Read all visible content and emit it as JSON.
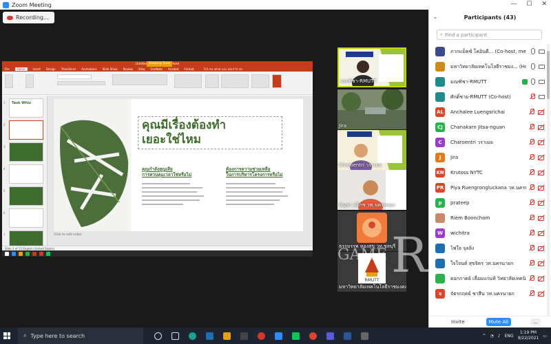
{
  "window": {
    "title": "Zoom Meeting"
  },
  "recording": {
    "label": "Recording..."
  },
  "powerpoint": {
    "window_title": "Untitled design - PowerPoint",
    "drawing_tools_tab": "Drawing Tools",
    "tabs": [
      "File",
      "Home",
      "Insert",
      "Design",
      "Transitions",
      "Animations",
      "Slide Show",
      "Review",
      "View",
      "OneNote",
      "Acrobat",
      "Format"
    ],
    "tell_me": "Tell me what you want to do",
    "slide": {
      "title_line1": "คุณมีเรื่องต้องทำ",
      "title_line2": "เยอะใช่ไหม",
      "col1_head_line1": "คุณกำลังสูญเสีย",
      "col1_head_line2": "การควบคุมเวลาใช่หรือไม่",
      "col2_head_line1": "ต้องการความช่วยเหลือ",
      "col2_head_line2": "ในการบริหารโครงการหรือไม่"
    },
    "notes_placeholder": "Click to add notes",
    "status_text": "Slide 2 of 15   English (United States)",
    "thumb_numbers": [
      "1",
      "2",
      "3",
      "4",
      "5",
      "6",
      "7"
    ],
    "thumb1_text": "Task Whiz"
  },
  "video_tiles": [
    {
      "label": "มณฑิชา-RMUTT",
      "active": true
    },
    {
      "label": "Jira",
      "active": false
    },
    {
      "label": "Charoentri วราเมย",
      "active": false
    },
    {
      "label": "บัญชา สุโภช วพ.นครคลอง",
      "active": false
    },
    {
      "label": "ธรรมรรพ ทองสุข วท.ชลบุรี",
      "active": false
    },
    {
      "label": "มหาวิทยาลัยเทคโนโลยีราชมงคลธัญบุรี",
      "active": false
    }
  ],
  "watermark": {
    "text": "GAME",
    "text2": "R"
  },
  "participants": {
    "title": "Participants (43)",
    "search_placeholder": "Find a participant",
    "list": [
      {
        "initial": "",
        "name": "ภากแม็คซ์ โคอินดี... (Co-host, me)",
        "color": "#3a4a8c",
        "mic": "on",
        "cam": "on"
      },
      {
        "initial": "",
        "name": "มหาวิทยาลัยเทคโนโลยีราชมง... (Host)",
        "color": "#d08a1a",
        "mic": "on",
        "cam": "on"
      },
      {
        "initial": "",
        "name": "มณฑิชา-RMUTT",
        "color": "#1e8c8c",
        "mic": "on",
        "cam": "on",
        "green": true
      },
      {
        "initial": "",
        "name": "ศักดิ์ชาย-RMUTT (Co-host)",
        "color": "#1e8c8c",
        "mic": "off",
        "cam": "on"
      },
      {
        "initial": "AL",
        "name": "Anchalee Luengsrichai",
        "color": "#d9462b",
        "mic": "off",
        "cam": "off"
      },
      {
        "initial": "CJ",
        "name": "Chanakarn Jitsa-nguan",
        "color": "#2bb24c",
        "mic": "off",
        "cam": "off"
      },
      {
        "initial": "C",
        "name": "Charoentri วราเมย",
        "color": "#9b3ec9",
        "mic": "off",
        "cam": "off"
      },
      {
        "initial": "J",
        "name": "Jira",
        "color": "#e07b1a",
        "mic": "off",
        "cam": "off"
      },
      {
        "initial": "KN",
        "name": "Krutoss NYTC",
        "color": "#d9462b",
        "mic": "off",
        "cam": "off"
      },
      {
        "initial": "PR",
        "name": "Piya Ruengrongluckana วท.นครนายก",
        "color": "#d9462b",
        "mic": "off",
        "cam": "off"
      },
      {
        "initial": "p",
        "name": "prateep",
        "color": "#2bb24c",
        "mic": "off",
        "cam": "off"
      },
      {
        "initial": "",
        "name": "Riem Boonchom",
        "color": "#c98a6a",
        "mic": "off",
        "cam": "off"
      },
      {
        "initial": "W",
        "name": "wichitra",
        "color": "#9b3ec9",
        "mic": "off",
        "cam": "off"
      },
      {
        "initial": "",
        "name": "ไฟใจ จุลลิ่ง",
        "color": "#1e6fb0",
        "mic": "off",
        "cam": "off"
      },
      {
        "initial": "",
        "name": "ใจใจนต์ สุขจิตร วท.นครนายก",
        "color": "#1e6fb0",
        "mic": "off",
        "cam": "off"
      },
      {
        "initial": "",
        "name": "ดอกกาตย์ เลื่อมแก่นท้ วิทยาลัยเทคนิค...",
        "color": "#2bb24c",
        "mic": "off",
        "cam": "off"
      },
      {
        "initial": "จ",
        "name": "จัตรกฤตย์ ชาสีน วท.นครนายก",
        "color": "#d9462b",
        "mic": "off",
        "cam": "off"
      }
    ],
    "invite_label": "Invite",
    "mute_all_label": "Mute All",
    "more_label": "..."
  },
  "taskbar": {
    "search_placeholder": "Type here to search",
    "language": "ENG",
    "time": "1:19 PM",
    "date": "9/22/2021"
  },
  "colors": {
    "zoom_blue": "#2d8cff",
    "ppt_red": "#c43e1c",
    "slide_green": "#3f6b2f",
    "mute_red": "#d9362b"
  }
}
